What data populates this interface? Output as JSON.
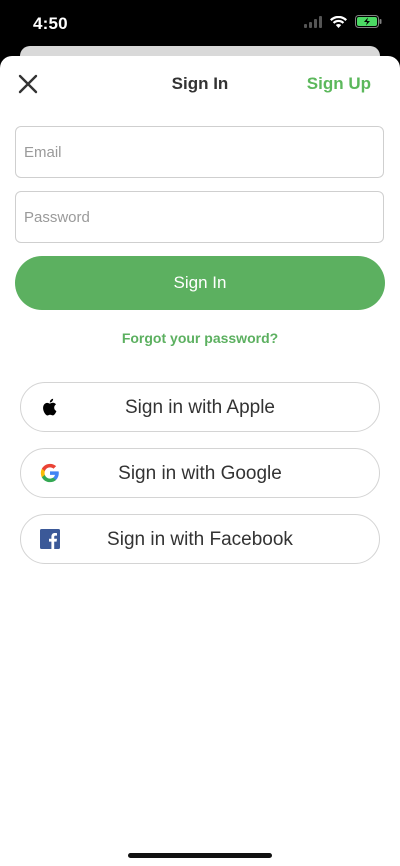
{
  "status_bar": {
    "time": "4:50"
  },
  "nav": {
    "title": "Sign In",
    "signup_label": "Sign Up",
    "close_icon": "close-icon"
  },
  "form": {
    "email_placeholder": "Email",
    "password_placeholder": "Password",
    "email_value": "",
    "password_value": "",
    "signin_label": "Sign In",
    "forgot_label": "Forgot your password?"
  },
  "social": {
    "apple_label": "Sign in with Apple",
    "google_label": "Sign in with Google",
    "facebook_label": "Sign in with Facebook",
    "icons": [
      "apple-icon",
      "google-icon",
      "facebook-icon"
    ]
  },
  "colors": {
    "accent": "#5cb060",
    "facebook": "#3b5998"
  }
}
